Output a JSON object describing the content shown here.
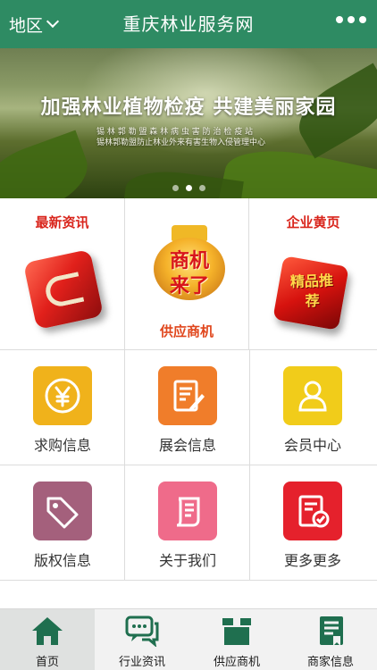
{
  "header": {
    "region_label": "地区",
    "title": "重庆林业服务网",
    "bg_color": "#2e8b63"
  },
  "banner": {
    "headline": "加强林业植物检疫  共建美丽家园",
    "sub_line_1": "锡 林 郭 勒 盟 森 林 病 虫 害 防 治 检 疫 站",
    "sub_line_2": "锡林郭勒盟防止林业外来有害生物入侵管理中心",
    "slide_count": 3,
    "active_slide": 1
  },
  "promo": {
    "news_label": "最新资讯",
    "supply_label": "供应商机",
    "supply_badge_1": "商机",
    "supply_badge_2": "来了",
    "yellow_pages_label": "企业黄页",
    "yellow_pages_badge": "精品推荐"
  },
  "grid": {
    "items": [
      {
        "label": "求购信息",
        "icon": "yen-icon",
        "color": "#f0b21b"
      },
      {
        "label": "展会信息",
        "icon": "document-edit-icon",
        "color": "#f07d2a"
      },
      {
        "label": "会员中心",
        "icon": "user-icon",
        "color": "#f1cc1a"
      },
      {
        "label": "版权信息",
        "icon": "tag-icon",
        "color": "#a4607c"
      },
      {
        "label": "关于我们",
        "icon": "scroll-icon",
        "color": "#ef6b8a"
      },
      {
        "label": "更多更多",
        "icon": "checklist-icon",
        "color": "#e5212c"
      }
    ]
  },
  "tabbar": {
    "accent_color": "#1f6f4f",
    "items": [
      {
        "label": "首页",
        "icon": "home-icon"
      },
      {
        "label": "行业资讯",
        "icon": "chat-icon"
      },
      {
        "label": "供应商机",
        "icon": "box-icon"
      },
      {
        "label": "商家信息",
        "icon": "bookmark-doc-icon"
      }
    ]
  }
}
